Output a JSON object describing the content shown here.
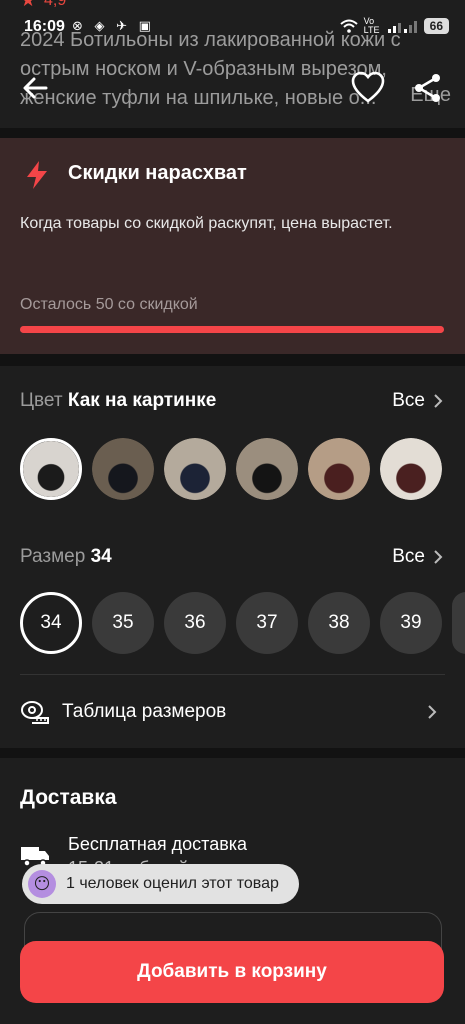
{
  "status_bar": {
    "time": "16:09",
    "left_icons": "⊗ ◈ ✈ ▣",
    "network": "Vo LTE",
    "battery": "66"
  },
  "product": {
    "rating": "4,9",
    "title": "2024 Ботильоны из лакированной кожи с острым носком и V-образным вырезом, женские туфли на шпильке, новые о...",
    "more": "Еще"
  },
  "nav": {
    "back_icon": "arrow-left-icon",
    "favorite_icon": "heart-icon",
    "share_icon": "share-icon"
  },
  "discount": {
    "title": "Скидки нарасхват",
    "description": "Когда товары со скидкой раскупят, цена вырастет.",
    "remaining": "Осталось 50 со скидкой",
    "progress_fraction": 1.0
  },
  "color": {
    "label": "Цвет",
    "value": "Как на картинке",
    "all": "Все",
    "swatches": [
      {
        "selected": true,
        "bg": "#d8d4cf",
        "fg": "#1b1b1b"
      },
      {
        "selected": false,
        "bg": "#6a5e50",
        "fg": "#15171d"
      },
      {
        "selected": false,
        "bg": "#b4aa9c",
        "fg": "#1c2336"
      },
      {
        "selected": false,
        "bg": "#9b8e7e",
        "fg": "#141414"
      },
      {
        "selected": false,
        "bg": "#b59d86",
        "fg": "#4a1f1f"
      },
      {
        "selected": false,
        "bg": "#e3ddd5",
        "fg": "#4a2020"
      }
    ]
  },
  "size": {
    "label": "Размер",
    "value": "34",
    "all": "Все",
    "options": [
      "34",
      "35",
      "36",
      "37",
      "38",
      "39"
    ],
    "selected_index": 0,
    "table_label": "Таблица размеров"
  },
  "delivery": {
    "title": "Доставка",
    "line1": "Бесплатная доставка",
    "line2": "15-21 рабочий день"
  },
  "toast": {
    "emoji": "😶",
    "text": "1 человек оценил этот товар"
  },
  "cart_button": "Добавить в корзину",
  "colors": {
    "accent": "#f44548",
    "discount_bg": "#3a2828",
    "card_bg": "#1e1e1e"
  }
}
